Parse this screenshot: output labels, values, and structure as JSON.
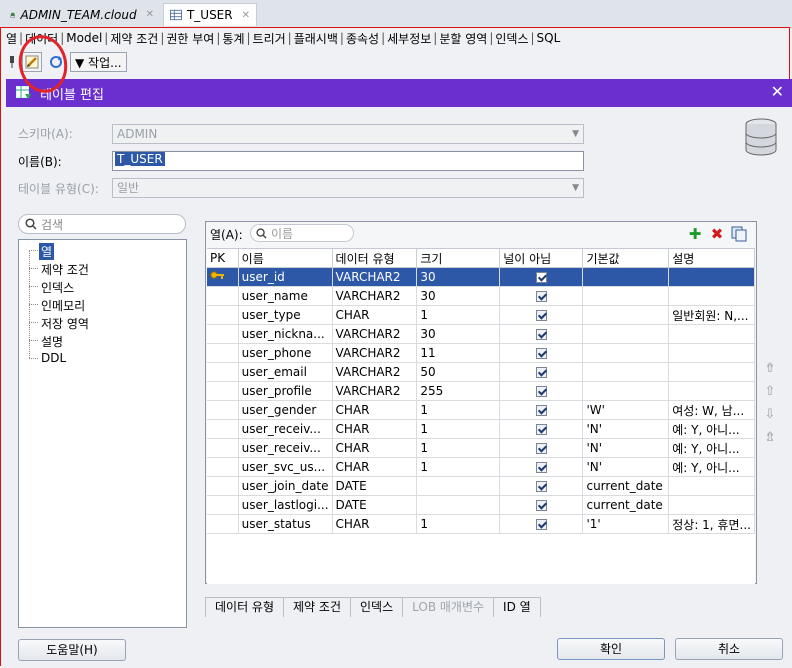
{
  "app_tabs": [
    {
      "label": "ADMIN_TEAM.cloud",
      "icon": "sql-worksheet-icon"
    },
    {
      "label": "T_USER",
      "icon": "table-icon"
    }
  ],
  "sub_tabs": [
    "열",
    "데이터",
    "Model",
    "제약 조건",
    "권한 부여",
    "통계",
    "트리거",
    "플래시백",
    "종속성",
    "세부정보",
    "분할 영역",
    "인덱스",
    "SQL"
  ],
  "toolbar": {
    "actions_label": "▼ 작업..."
  },
  "dialog": {
    "title": "테이블 편집",
    "schema_label": "스키마(A):",
    "schema_value": "ADMIN",
    "name_label": "이름(B):",
    "name_value": "T_USER",
    "type_label": "테이블 유형(C):",
    "type_value": "일반",
    "left_search_placeholder": "검색",
    "tree": [
      "열",
      "제약 조건",
      "인덱스",
      "인메모리",
      "저장 영역",
      "설명",
      "DDL"
    ],
    "columns_label": "열(A):",
    "columns_search_placeholder": "이름",
    "table_headers": [
      "PK",
      "이름",
      "데이터 유형",
      "크기",
      "널이 아님",
      "기본값",
      "설명"
    ],
    "rows": [
      {
        "pk": true,
        "name": "user_id",
        "type": "VARCHAR2",
        "size": "30",
        "notnull": true,
        "default": "",
        "desc": ""
      },
      {
        "pk": false,
        "name": "user_name",
        "type": "VARCHAR2",
        "size": "30",
        "notnull": true,
        "default": "",
        "desc": ""
      },
      {
        "pk": false,
        "name": "user_type",
        "type": "CHAR",
        "size": "1",
        "notnull": true,
        "default": "",
        "desc": "일반회원: N,..."
      },
      {
        "pk": false,
        "name": "user_nickna...",
        "type": "VARCHAR2",
        "size": "30",
        "notnull": true,
        "default": "",
        "desc": ""
      },
      {
        "pk": false,
        "name": "user_phone",
        "type": "VARCHAR2",
        "size": "11",
        "notnull": true,
        "default": "",
        "desc": ""
      },
      {
        "pk": false,
        "name": "user_email",
        "type": "VARCHAR2",
        "size": "50",
        "notnull": true,
        "default": "",
        "desc": ""
      },
      {
        "pk": false,
        "name": "user_profile",
        "type": "VARCHAR2",
        "size": "255",
        "notnull": true,
        "default": "",
        "desc": ""
      },
      {
        "pk": false,
        "name": "user_gender",
        "type": "CHAR",
        "size": "1",
        "notnull": true,
        "default": "'W'",
        "desc": "여성: W, 남..."
      },
      {
        "pk": false,
        "name": "user_receiv...",
        "type": "CHAR",
        "size": "1",
        "notnull": true,
        "default": "'N'",
        "desc": "예: Y, 아니..."
      },
      {
        "pk": false,
        "name": "user_receiv...",
        "type": "CHAR",
        "size": "1",
        "notnull": true,
        "default": "'N'",
        "desc": "예: Y, 아니..."
      },
      {
        "pk": false,
        "name": "user_svc_us...",
        "type": "CHAR",
        "size": "1",
        "notnull": true,
        "default": "'N'",
        "desc": "예: Y, 아니..."
      },
      {
        "pk": false,
        "name": "user_join_date",
        "type": "DATE",
        "size": "",
        "notnull": true,
        "default": "current_date",
        "desc": ""
      },
      {
        "pk": false,
        "name": "user_lastlogi...",
        "type": "DATE",
        "size": "",
        "notnull": true,
        "default": "current_date",
        "desc": ""
      },
      {
        "pk": false,
        "name": "user_status",
        "type": "CHAR",
        "size": "1",
        "notnull": true,
        "default": "'1'",
        "desc": "정상: 1, 휴면..."
      }
    ],
    "bottom_tabs": [
      "데이터 유형",
      "제약 조건",
      "인덱스",
      "LOB 매개변수",
      "ID 열"
    ],
    "help_button": "도움말(H)",
    "ok_button": "확인",
    "cancel_button": "취소"
  },
  "colors": {
    "title_bar": "#6b2fd0",
    "selection": "#2d58a8",
    "annotation": "#e3232a"
  }
}
